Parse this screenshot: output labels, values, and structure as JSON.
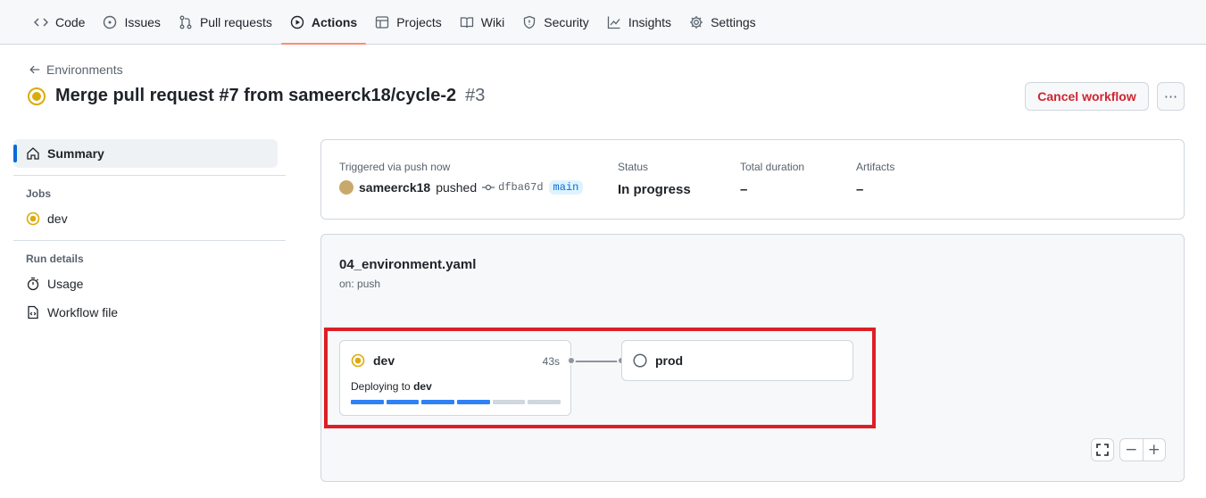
{
  "nav": {
    "tabs": [
      {
        "label": "Code",
        "icon": "code-icon"
      },
      {
        "label": "Issues",
        "icon": "issue-icon"
      },
      {
        "label": "Pull requests",
        "icon": "pull-request-icon"
      },
      {
        "label": "Actions",
        "icon": "play-icon",
        "active": true
      },
      {
        "label": "Projects",
        "icon": "table-icon"
      },
      {
        "label": "Wiki",
        "icon": "book-icon"
      },
      {
        "label": "Security",
        "icon": "shield-icon"
      },
      {
        "label": "Insights",
        "icon": "graph-icon"
      },
      {
        "label": "Settings",
        "icon": "gear-icon"
      }
    ]
  },
  "header": {
    "back_label": "Environments",
    "title": "Merge pull request #7 from sameerck18/cycle-2",
    "run_number": "#3",
    "cancel_label": "Cancel workflow",
    "more_label": "···"
  },
  "sidebar": {
    "summary_label": "Summary",
    "jobs_heading": "Jobs",
    "jobs": [
      {
        "label": "dev",
        "status": "in-progress"
      }
    ],
    "run_details_heading": "Run details",
    "run_details": [
      {
        "label": "Usage",
        "icon": "stopwatch-icon"
      },
      {
        "label": "Workflow file",
        "icon": "file-code-icon"
      }
    ]
  },
  "summary": {
    "trigger_label": "Triggered via push now",
    "actor": "sameerck18",
    "action": "pushed",
    "commit": "dfba67d",
    "branch": "main",
    "status_label": "Status",
    "status_value": "In progress",
    "duration_label": "Total duration",
    "duration_value": "–",
    "artifacts_label": "Artifacts",
    "artifacts_value": "–"
  },
  "graph": {
    "workflow_name": "04_environment.yaml",
    "trigger": "on: push",
    "jobs": [
      {
        "name": "dev",
        "duration": "43s",
        "subtitle_prefix": "Deploying to",
        "subtitle_target": "dev",
        "progress_fraction": 0.67,
        "progress_segments": 6
      },
      {
        "name": "prod",
        "status": "queued"
      }
    ],
    "controls": {
      "fullscreen": "⛶",
      "zoom_out": "−",
      "zoom_in": "+"
    }
  },
  "colors": {
    "accent_tab": "#fd8c73",
    "in_progress": "#dbab0a",
    "danger": "#d1242f",
    "link": "#0969da",
    "highlight": "#dc1f26"
  }
}
